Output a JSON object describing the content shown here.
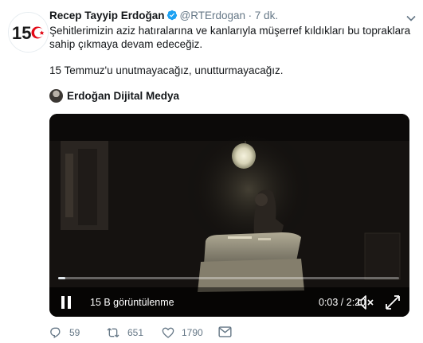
{
  "tweet": {
    "display_name": "Recep Tayyip Erdoğan",
    "handle": "@RTErdogan",
    "separator": "·",
    "time": "7 dk.",
    "text_line1": "Şehitlerimizin aziz hatıralarına ve kanlarıyla müşerref kıldıkları bu topraklara sahip çıkmaya devam edeceğiz.",
    "text_line2": "15 Temmuz'u unutmayacağız, unutturmayacağız.",
    "source_name": "Erdoğan Dijital Medya"
  },
  "avatar": {
    "badge_text": "15"
  },
  "video": {
    "views_label": "15 B görüntülenme",
    "timecode": "0:03 / 2:20",
    "progress_fraction": 0.02
  },
  "actions": {
    "reply_count": "59",
    "retweet_count": "651",
    "like_count": "1790"
  },
  "colors": {
    "verified": "#1da1f2",
    "text": "#14171a",
    "secondary": "#657786",
    "badge_red": "#e30a17"
  },
  "icons": [
    "verified-badge-icon",
    "chevron-down-icon",
    "pause-icon",
    "volume-icon",
    "fullscreen-icon",
    "reply-icon",
    "retweet-icon",
    "like-icon",
    "direct-message-icon"
  ]
}
